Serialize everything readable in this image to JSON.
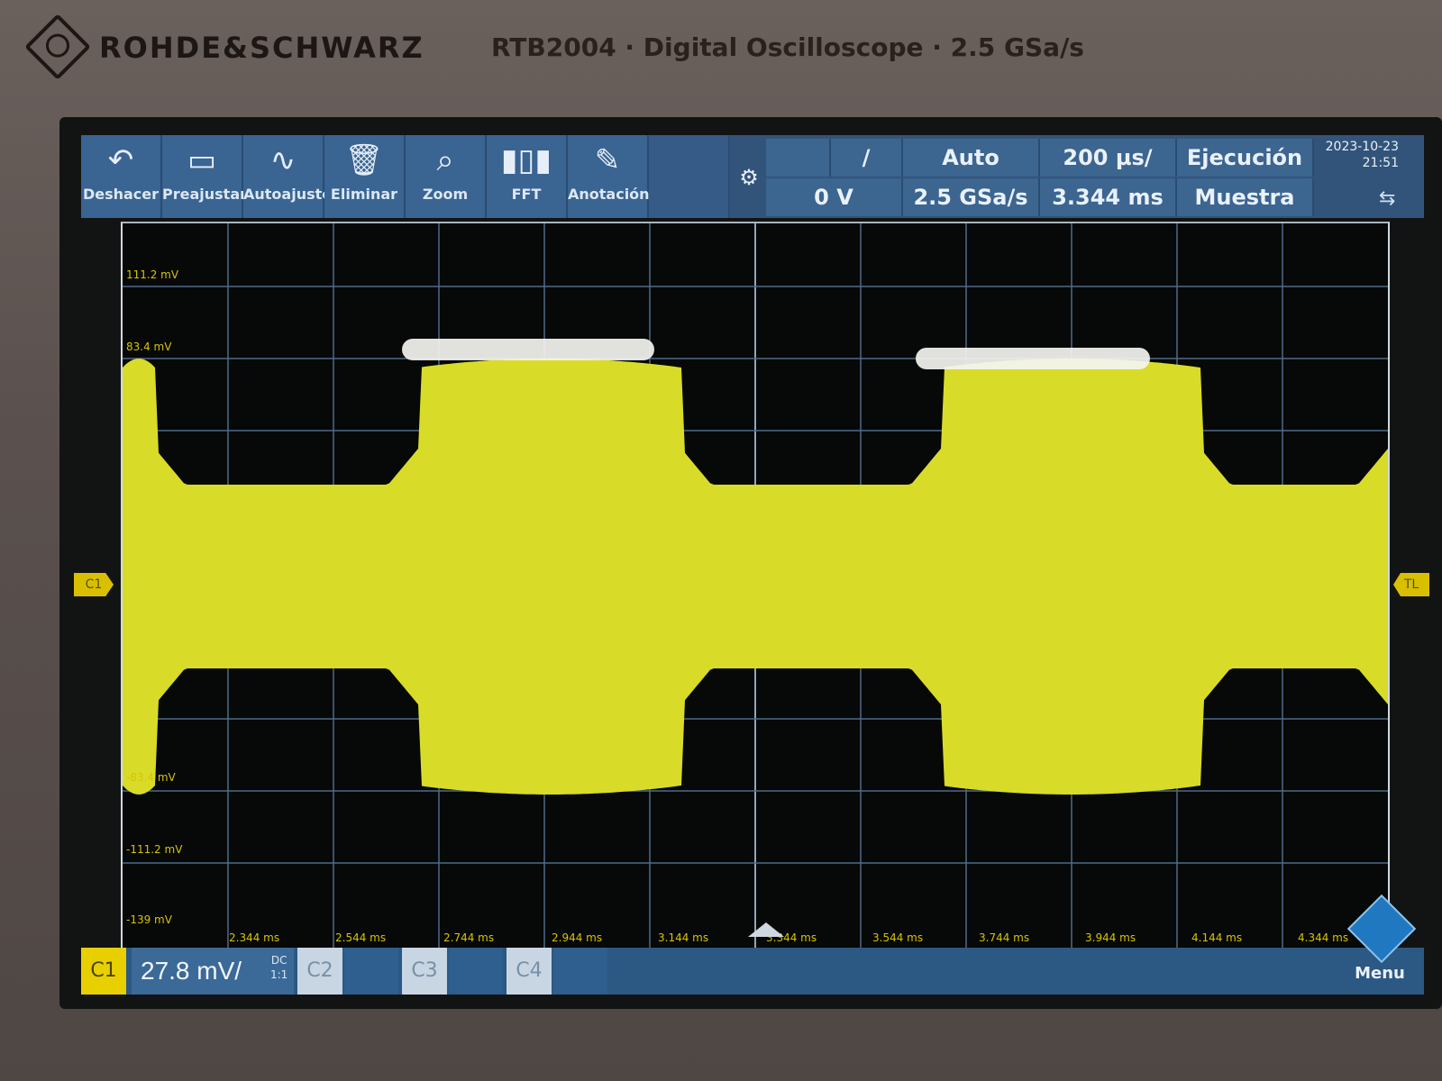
{
  "header": {
    "brand": "ROHDE&SCHWARZ",
    "model": "RTB2004 · Digital Oscilloscope · 2.5 GSa/s"
  },
  "toolbar": {
    "buttons": [
      {
        "label": "Deshacer",
        "icon": "undo-icon"
      },
      {
        "label": "Preajustar",
        "icon": "preset-icon"
      },
      {
        "label": "Autoajuste",
        "icon": "autoset-icon"
      },
      {
        "label": "Eliminar",
        "icon": "trash-icon"
      },
      {
        "label": "Zoom",
        "icon": "zoom-icon"
      },
      {
        "label": "FFT",
        "icon": "fft-icon"
      },
      {
        "label": "Anotación",
        "icon": "pencil-icon"
      }
    ]
  },
  "trigger": {
    "source": "C1",
    "slope": "/",
    "level": "0 V",
    "mode": "Auto",
    "sample_rate": "2.5 GSa/s",
    "time_scale": "200 µs/",
    "time_position": "3.344 ms",
    "run_state": "Ejecución",
    "acq_mode": "Muestra"
  },
  "status": {
    "date": "2023-10-23",
    "time": "21:51"
  },
  "plot": {
    "voltage_labels": [
      "111.2 mV",
      "83.4 mV",
      "-83.4 mV",
      "-111.2 mV",
      "-139 mV"
    ],
    "time_labels": [
      "2.344 ms",
      "2.544 ms",
      "2.744 ms",
      "2.944 ms",
      "3.144 ms",
      "3.344 ms",
      "3.544 ms",
      "3.744 ms",
      "3.944 ms",
      "4.144 ms",
      "4.344 ms"
    ],
    "ch1_marker": "C1",
    "tl_marker": "TL",
    "trace_color": "#d8dc28"
  },
  "channels": {
    "c1_label": "C1",
    "c1_scale": "27.8 mV/",
    "c1_coupling": "DC",
    "c1_coupling2": "1:1",
    "c2_label": "C2",
    "c3_label": "C3",
    "c4_label": "C4"
  },
  "menu_label": "Menu"
}
